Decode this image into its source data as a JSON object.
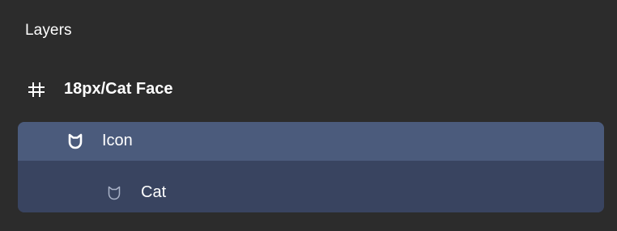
{
  "panel": {
    "title": "Layers"
  },
  "frame": {
    "label": "18px/Cat Face",
    "icon": "hash-icon"
  },
  "layers": [
    {
      "label": "Icon",
      "icon": "cat-face-filled-icon",
      "state": "selected"
    },
    {
      "label": "Cat",
      "icon": "cat-face-outline-icon",
      "state": "child-of-selected"
    }
  ],
  "colors": {
    "background": "#2c2c2c",
    "selected_row": "#4b5b7c",
    "selected_child_row": "#394460",
    "text": "#ffffff",
    "muted_icon": "#aab3c8"
  }
}
